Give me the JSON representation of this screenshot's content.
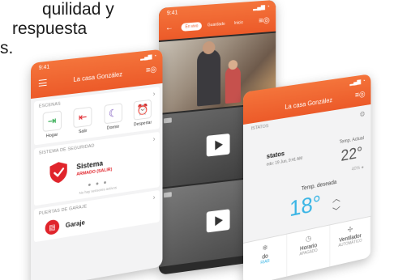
{
  "headline": {
    "line1": "quilidad y",
    "line2": "respuesta",
    "line3": "s."
  },
  "left_phone": {
    "status_time": "9:41",
    "title": "La casa González",
    "scenes": {
      "label": "ESCENAS",
      "items": [
        {
          "name": "Hogar",
          "icon": "home-enter-icon",
          "color": "#2aa84a"
        },
        {
          "name": "Salir",
          "icon": "home-exit-icon",
          "color": "#e0242b"
        },
        {
          "name": "Dormir",
          "icon": "moon-icon",
          "color": "#6a3fb5"
        },
        {
          "name": "Despertar",
          "icon": "alarm-clock-icon",
          "color": "#f2b01e"
        }
      ]
    },
    "security": {
      "label": "SISTEMA DE SEGURIDAD",
      "name": "Sistema",
      "status": "ARMADO (SALIR)",
      "note": "No hay sensores activos"
    },
    "garage": {
      "label": "PUERTAS DE GARAJE",
      "name": "Garaje"
    }
  },
  "middle_phone": {
    "status_time": "9:41",
    "tabs": [
      "En vivo",
      "Guardado",
      "Inicio"
    ]
  },
  "right_phone": {
    "title": "La casa González",
    "section": "ISTATOS",
    "thermostat_name": "statos",
    "date": "edo: 19 Jun, 9:41 AM",
    "actual_label": "Temp. Actual",
    "actual_value": "22°",
    "humidity": "40%",
    "desired_label": "Temp. deseada",
    "desired_value": "18°",
    "modes": [
      {
        "name": "do",
        "value": "RIAR"
      },
      {
        "name": "Horario",
        "value": "APAGADO"
      },
      {
        "name": "Ventilador",
        "value": "AUTOMÁTICO"
      }
    ]
  },
  "colors": {
    "brand_orange": "#ec5a29",
    "alarm_red": "#e0242b",
    "temp_blue": "#3ab5e5"
  }
}
